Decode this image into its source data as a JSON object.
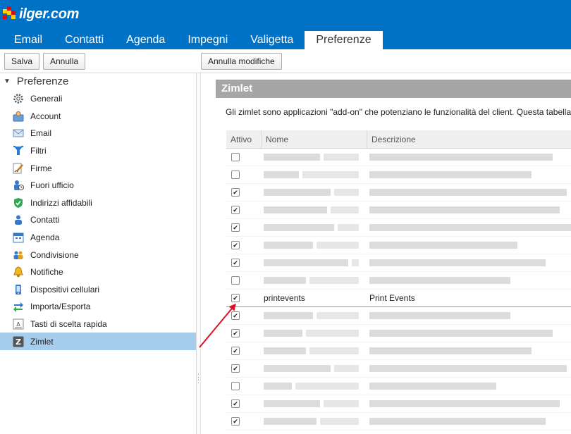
{
  "header": {
    "logo_text": "ilger.com",
    "tabs": [
      {
        "label": "Email",
        "active": false
      },
      {
        "label": "Contatti",
        "active": false
      },
      {
        "label": "Agenda",
        "active": false
      },
      {
        "label": "Impegni",
        "active": false
      },
      {
        "label": "Valigetta",
        "active": false
      },
      {
        "label": "Preferenze",
        "active": true
      }
    ]
  },
  "toolbar": {
    "save_label": "Salva",
    "cancel_label": "Annulla",
    "undo_changes_label": "Annulla modifiche"
  },
  "sidebar": {
    "title": "Preferenze",
    "items": [
      {
        "label": "Generali",
        "icon": "gear-icon"
      },
      {
        "label": "Account",
        "icon": "account-icon"
      },
      {
        "label": "Email",
        "icon": "envelope-icon"
      },
      {
        "label": "Filtri",
        "icon": "filter-icon"
      },
      {
        "label": "Firme",
        "icon": "signature-icon"
      },
      {
        "label": "Fuori ufficio",
        "icon": "out-of-office-icon"
      },
      {
        "label": "Indirizzi affidabili",
        "icon": "shield-check-icon"
      },
      {
        "label": "Contatti",
        "icon": "contact-icon"
      },
      {
        "label": "Agenda",
        "icon": "calendar-icon"
      },
      {
        "label": "Condivisione",
        "icon": "sharing-icon"
      },
      {
        "label": "Notifiche",
        "icon": "bell-icon"
      },
      {
        "label": "Dispositivi cellulari",
        "icon": "mobile-icon"
      },
      {
        "label": "Importa/Esporta",
        "icon": "import-export-icon"
      },
      {
        "label": "Tasti di scelta rapida",
        "icon": "keyboard-icon"
      },
      {
        "label": "Zimlet",
        "icon": "zimlet-icon",
        "active": true
      }
    ]
  },
  "main": {
    "section_title": "Zimlet",
    "intro": "Gli zimlet sono applicazioni \"add-on\" che potenziano le funzionalità del client. Questa tabella",
    "columns": {
      "active": "Attivo",
      "name": "Nome",
      "description": "Descrizione"
    },
    "rows": [
      {
        "checked": false,
        "name": "",
        "description": ""
      },
      {
        "checked": false,
        "name": "",
        "description": ""
      },
      {
        "checked": true,
        "name": "",
        "description": ""
      },
      {
        "checked": true,
        "name": "",
        "description": ""
      },
      {
        "checked": true,
        "name": "",
        "description": ""
      },
      {
        "checked": true,
        "name": "",
        "description": ""
      },
      {
        "checked": true,
        "name": "",
        "description": ""
      },
      {
        "checked": false,
        "name": "",
        "description": ""
      },
      {
        "checked": true,
        "name": "printevents",
        "description": "Print Events"
      },
      {
        "checked": true,
        "name": "",
        "description": ""
      },
      {
        "checked": true,
        "name": "",
        "description": ""
      },
      {
        "checked": true,
        "name": "",
        "description": ""
      },
      {
        "checked": true,
        "name": "",
        "description": ""
      },
      {
        "checked": false,
        "name": "",
        "description": ""
      },
      {
        "checked": true,
        "name": "",
        "description": ""
      },
      {
        "checked": true,
        "name": "",
        "description": ""
      }
    ]
  },
  "colors": {
    "header_bg": "#0072c6",
    "selected_item_bg": "#a7cdec",
    "section_header_bg": "#a6a6a6",
    "arrow": "#e01020"
  }
}
